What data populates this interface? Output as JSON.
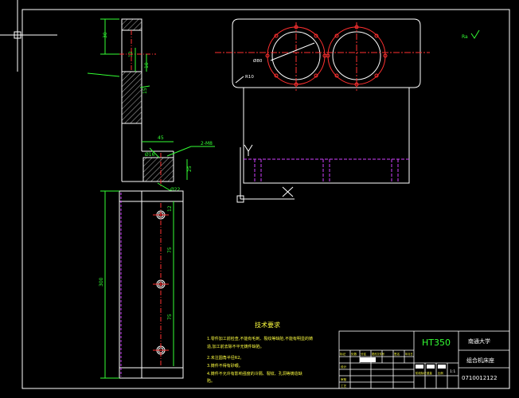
{
  "title_block": {
    "material": "HT350",
    "school": "南通大学",
    "part_name": "组合机床座",
    "drawing_no": "0710012122",
    "scale": "1:1",
    "header_cells": [
      "标记",
      "处数",
      "分区",
      "更改文件号",
      "签名",
      "年月日"
    ],
    "role_cells": [
      "设计",
      "审核",
      "工艺"
    ],
    "stage_cells": [
      "阶段标记",
      "重量",
      "比例"
    ]
  },
  "tech_notes": {
    "heading": "技术要求",
    "lines": [
      "1.零件加工前检查,不能有毛刺、裂纹等缺陷,不能有明显的铸",
      "造,加工前去除不平无铸件缺陷。",
      "2.未注圆角半径R2。",
      "3.铸件不得有砂眼。",
      "4.铸件不允许有影响强度的冷隔、裂纹、孔洞等铸造缺",
      "陷。"
    ]
  },
  "roughness": "Ra",
  "dims": {
    "d1": "30",
    "d2": "45",
    "d3": "12",
    "d4": "10",
    "d5": "15",
    "d6": "Ø16",
    "d7": "25",
    "d8": "2-M8",
    "d9": "Ø22",
    "d10": "300",
    "d11": "75",
    "d12": "75",
    "d13": "12",
    "d14": "Ø80",
    "d15": "R10",
    "d16": "15"
  },
  "colors": {
    "line": "#ffffff",
    "center": "#ff3030",
    "green": "#33ff33",
    "hidden": "#d040ff",
    "yellow": "#ffff40",
    "hatch": "#ffffff"
  }
}
